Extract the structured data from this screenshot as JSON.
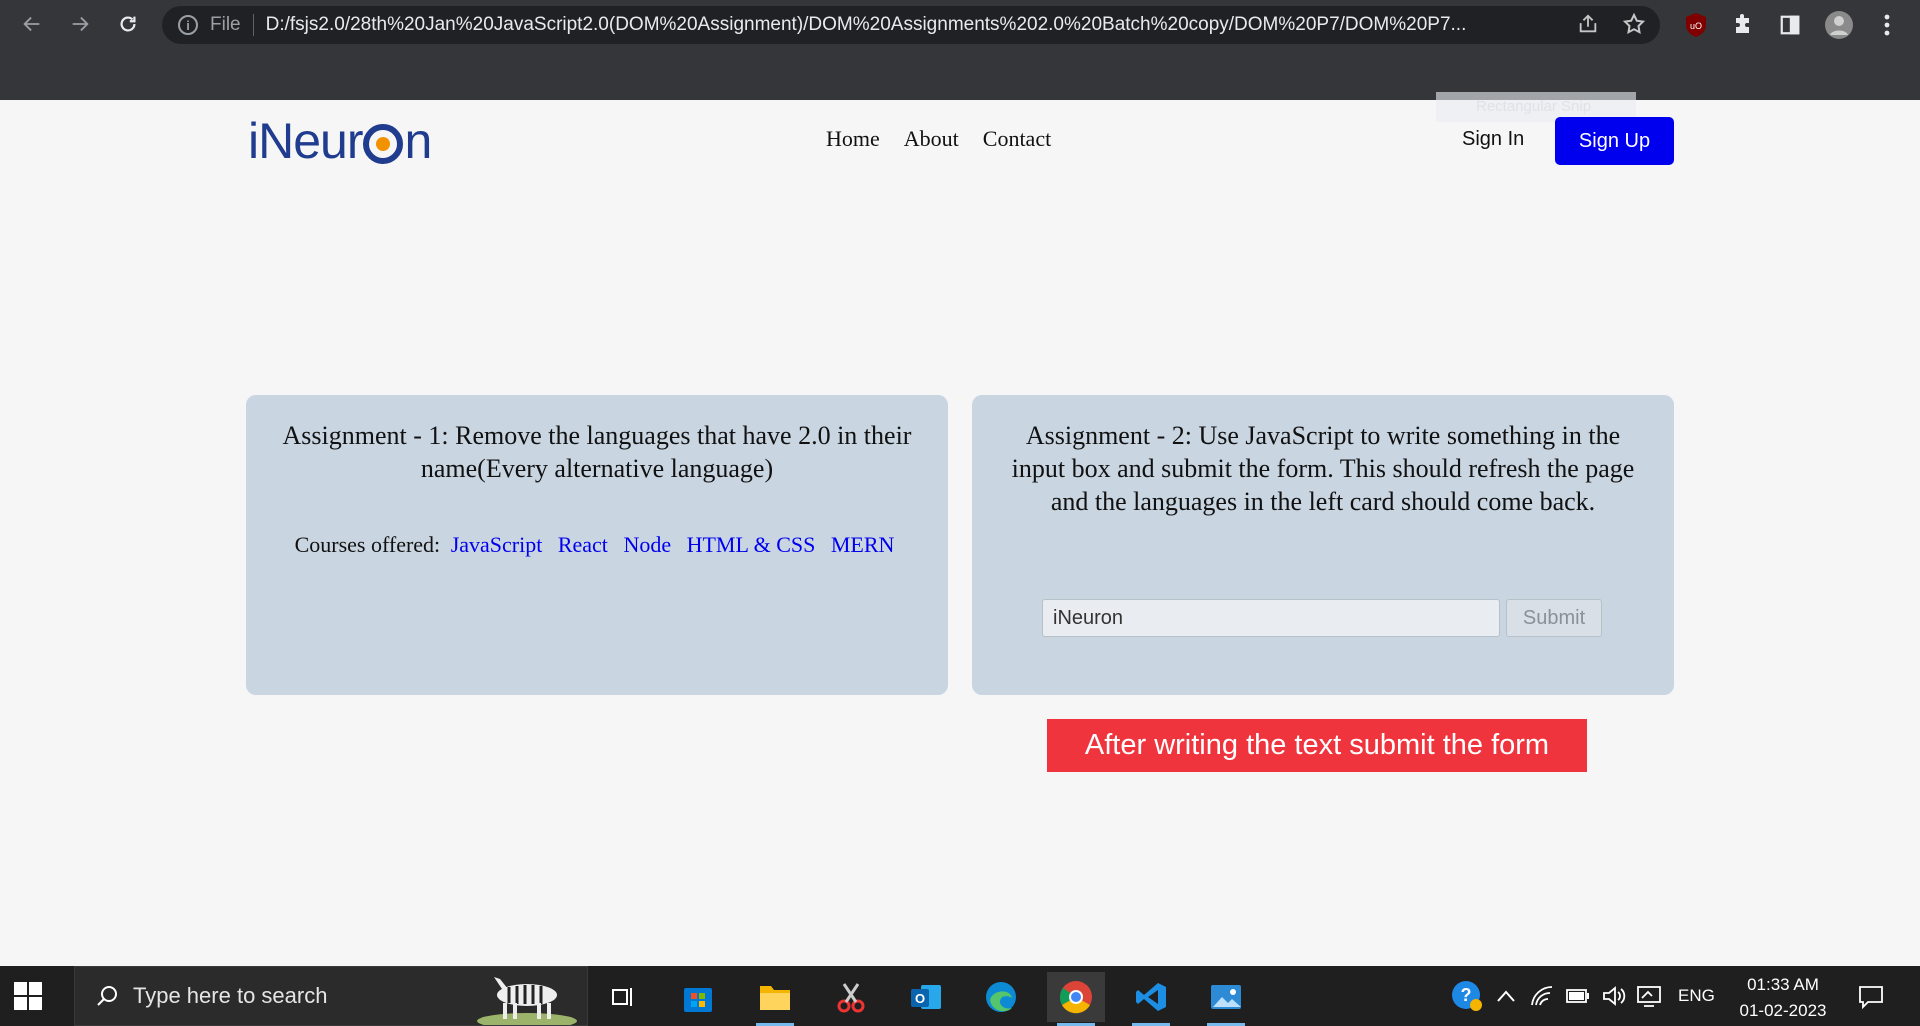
{
  "browser": {
    "url_scheme": "File",
    "url": "D:/fsjs2.0/28th%20Jan%20JavaScript2.0(DOM%20Assignment)/DOM%20Assignments%202.0%20Batch%20copy/DOM%20P7/DOM%20P7..."
  },
  "site": {
    "logo_text_pre": "iNeur",
    "logo_text_post": "n",
    "nav": [
      "Home",
      "About",
      "Contact"
    ],
    "sign_in": "Sign In",
    "sign_up": "Sign Up",
    "ghost_overlay": "Rectangular Snip"
  },
  "cards": {
    "assignment1_title": "Assignment - 1: Remove the languages that have 2.0 in their name(Every alternative language)",
    "courses_label": "Courses offered:",
    "courses": [
      "JavaScript",
      "React",
      "Node",
      "HTML & CSS",
      "MERN"
    ],
    "assignment2_title": "Assignment - 2: Use JavaScript to write something in the input box and submit the form. This should refresh the page and the languages in the left card should come back.",
    "input_value": "iNeuron",
    "submit_label": "Submit"
  },
  "notice": "After writing the text submit the form",
  "taskbar": {
    "search_placeholder": "Type here to search",
    "language": "ENG",
    "time": "01:33 AM",
    "date": "01-02-2023"
  },
  "colors": {
    "accent_blue": "#0000ee",
    "card_bg": "#c9d5e1",
    "notice_red": "#f0343d",
    "logo_blue": "#1f3c8f",
    "logo_orange": "#f39200"
  }
}
